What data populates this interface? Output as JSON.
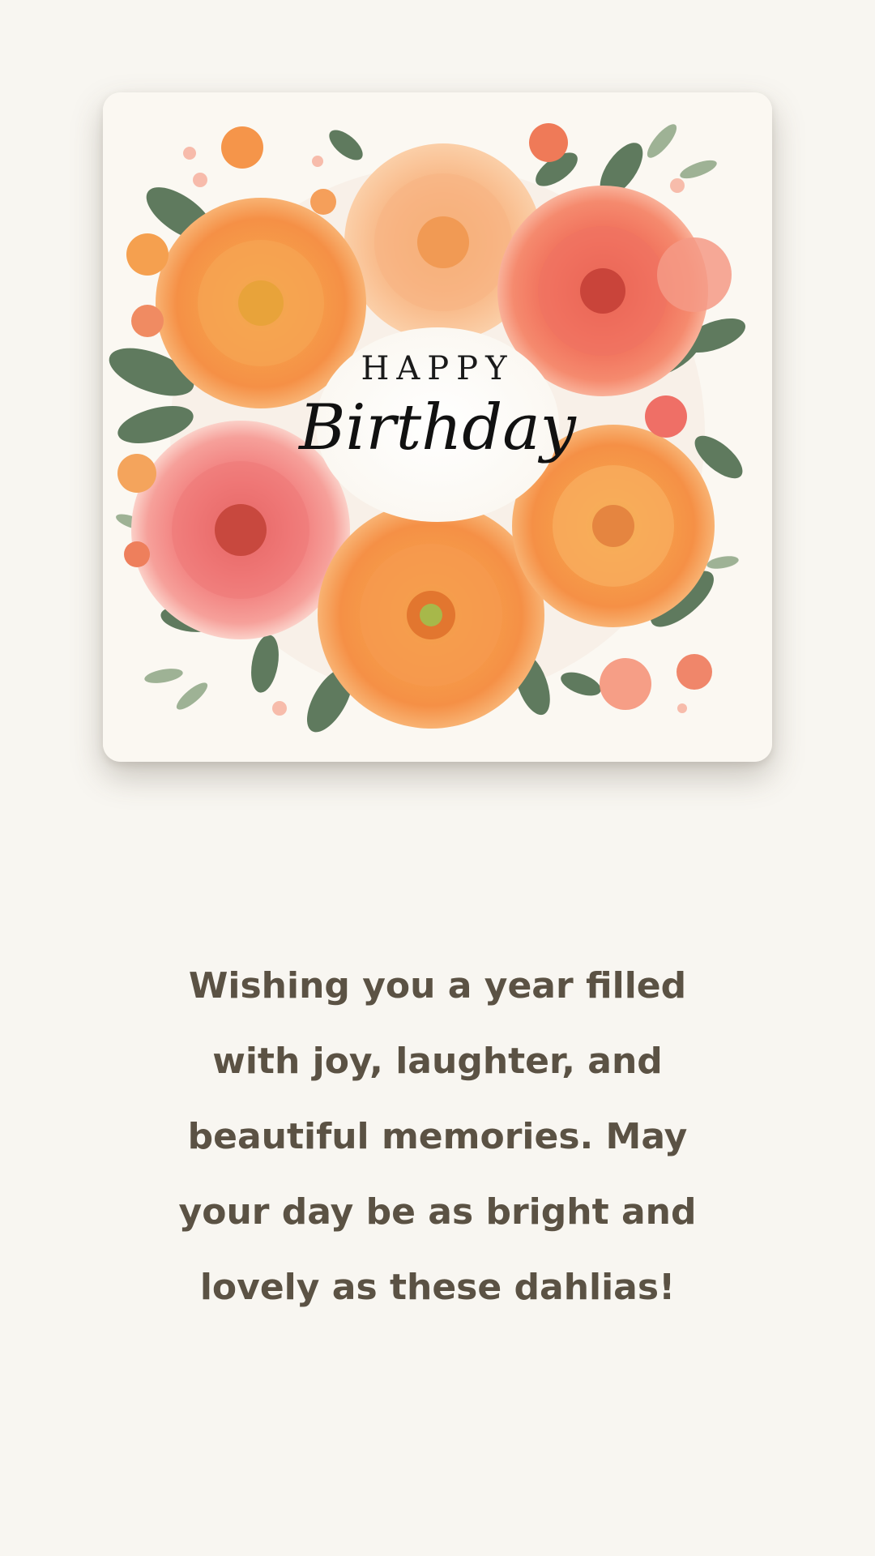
{
  "card": {
    "greeting_line1": "HAPPY",
    "greeting_line2": "Birthday",
    "illustration": "dahlia-flower-wreath"
  },
  "message": {
    "text": "Wishing you a year filled with joy, laughter, and beautiful memories. May your day be as bright and lovely as these dahlias!"
  },
  "colors": {
    "background": "#f8f6f1",
    "card": "#fbf8f2",
    "message_text": "#5b5244",
    "flower_orange": "#f5954a",
    "flower_coral": "#ee6a55",
    "flower_pink": "#f27a78",
    "leaf_green": "#5f7a5e"
  }
}
